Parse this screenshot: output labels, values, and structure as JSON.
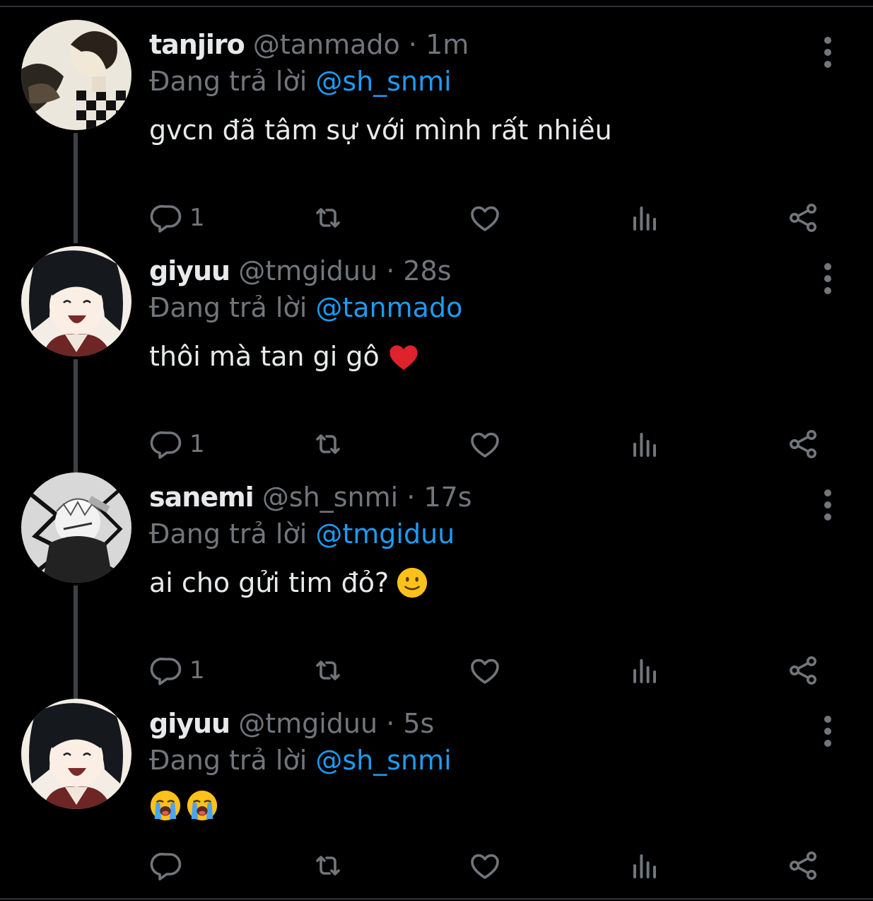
{
  "reply_prefix": "Đang trả lời",
  "colors": {
    "background": "#000000",
    "secondary_text": "#71767b",
    "mention": "#1d9bf0",
    "thread_line": "#3e4144"
  },
  "tweets": [
    {
      "name": "tanjiro",
      "handle": "@tanmado",
      "time": "1m",
      "reply_to": "@sh_snmi",
      "text": "gvcn đã tâm sự với mình rất nhiều",
      "emoji": "",
      "reply_count": "1",
      "avatar_icon": "tanjiro-avatar"
    },
    {
      "name": "giyuu",
      "handle": "@tmgiduu",
      "time": "28s",
      "reply_to": "@tanmado",
      "text": "thôi mà tan gi gô",
      "emoji": "red-heart",
      "reply_count": "1",
      "avatar_icon": "giyuu-avatar"
    },
    {
      "name": "sanemi",
      "handle": "@sh_snmi",
      "time": "17s",
      "reply_to": "@tmgiduu",
      "text": "ai cho gửi tim đỏ?",
      "emoji": "slightly-smiling-face",
      "reply_count": "1",
      "avatar_icon": "sanemi-avatar"
    },
    {
      "name": "giyuu",
      "handle": "@tmgiduu",
      "time": "5s",
      "reply_to": "@sh_snmi",
      "text": "",
      "emoji": "loudly-crying-face x2",
      "reply_count": "",
      "avatar_icon": "giyuu-avatar"
    }
  ]
}
